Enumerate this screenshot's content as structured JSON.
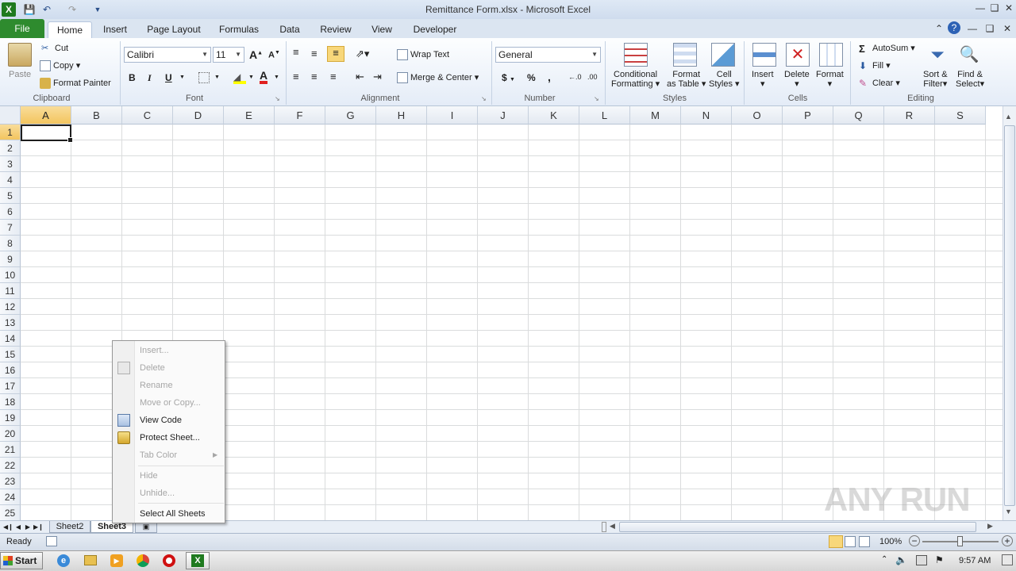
{
  "window": {
    "title": "Remittance Form.xlsx  -  Microsoft Excel"
  },
  "ribbon_tabs": [
    "File",
    "Home",
    "Insert",
    "Page Layout",
    "Formulas",
    "Data",
    "Review",
    "View",
    "Developer"
  ],
  "active_tab": "Home",
  "clipboard": {
    "paste": "Paste",
    "cut": "Cut",
    "copy": "Copy",
    "format_painter": "Format Painter",
    "label": "Clipboard"
  },
  "font": {
    "name": "Calibri",
    "size": "11",
    "label": "Font",
    "bold": "B",
    "italic": "I",
    "underline": "U"
  },
  "alignment": {
    "wrap_text": "Wrap Text",
    "merge_center": "Merge & Center",
    "label": "Alignment"
  },
  "number": {
    "format": "General",
    "currency": "$",
    "percent": "%",
    "comma": ",",
    "label": "Number"
  },
  "styles": {
    "conditional": "Conditional",
    "conditional2": "Formatting",
    "format_table": "Format",
    "format_table2": "as Table",
    "cell_styles": "Cell",
    "cell_styles2": "Styles",
    "label": "Styles"
  },
  "cells": {
    "insert": "Insert",
    "delete": "Delete",
    "format": "Format",
    "label": "Cells"
  },
  "editing": {
    "autosum": "AutoSum",
    "fill": "Fill",
    "clear": "Clear",
    "sort": "Sort &",
    "sort2": "Filter",
    "find": "Find &",
    "find2": "Select",
    "label": "Editing"
  },
  "columns": [
    "A",
    "B",
    "C",
    "D",
    "E",
    "F",
    "G",
    "H",
    "I",
    "J",
    "K",
    "L",
    "M",
    "N",
    "O",
    "P",
    "Q",
    "R",
    "S"
  ],
  "rows": [
    "1",
    "2",
    "3",
    "4",
    "5",
    "6",
    "7",
    "8",
    "9",
    "10",
    "11",
    "12",
    "13",
    "14",
    "15",
    "16",
    "17",
    "18",
    "19",
    "20",
    "21",
    "22",
    "23",
    "24",
    "25"
  ],
  "context_menu": {
    "items": [
      {
        "label": "Insert...",
        "enabled": false
      },
      {
        "label": "Delete",
        "enabled": false
      },
      {
        "label": "Rename",
        "enabled": false
      },
      {
        "label": "Move or Copy...",
        "enabled": false
      },
      {
        "label": "View Code",
        "enabled": true
      },
      {
        "label": "Protect Sheet...",
        "enabled": true
      },
      {
        "label": "Tab Color",
        "enabled": false
      },
      {
        "label": "Hide",
        "enabled": false
      },
      {
        "label": "Unhide...",
        "enabled": false
      },
      {
        "label": "Select All Sheets",
        "enabled": true
      }
    ]
  },
  "sheets": [
    "Sheet2",
    "Sheet3"
  ],
  "active_sheet": "Sheet3",
  "status": {
    "text": "Ready",
    "zoom": "100%"
  },
  "taskbar": {
    "start": "Start",
    "clock": "9:57 AM"
  },
  "watermark": "ANY RUN",
  "colors": {
    "file_tab": "#2e8b2e",
    "selection": "#f3c55f",
    "ribbon_bg": "#e4ecf7"
  }
}
